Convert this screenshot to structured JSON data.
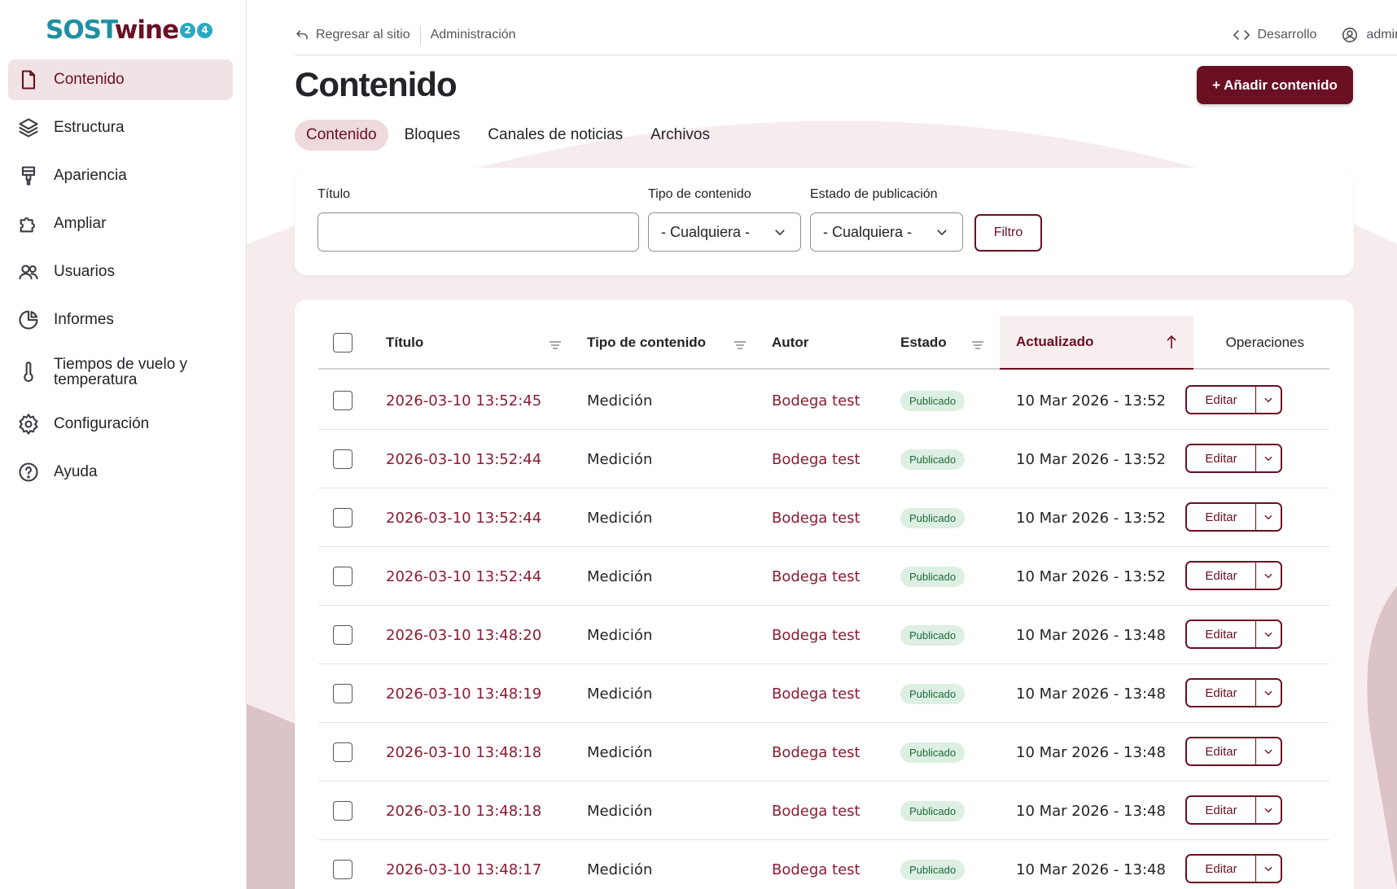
{
  "brand": {
    "logo_text_a": "SOST",
    "logo_text_b": "wine",
    "logo_badge": [
      "2",
      "4"
    ],
    "accent": "#6b0f23",
    "teal": "#1f8fa3"
  },
  "sidebar": {
    "items": [
      {
        "label": "Contenido",
        "icon": "document-icon",
        "active": true
      },
      {
        "label": "Estructura",
        "icon": "layers-icon",
        "active": false
      },
      {
        "label": "Apariencia",
        "icon": "paint-brush-icon",
        "active": false
      },
      {
        "label": "Ampliar",
        "icon": "puzzle-icon",
        "active": false
      },
      {
        "label": "Usuarios",
        "icon": "users-icon",
        "active": false
      },
      {
        "label": "Informes",
        "icon": "pie-chart-icon",
        "active": false
      },
      {
        "label": "Tiempos de vuelo y temperatura",
        "icon": "thermometer-icon",
        "active": false
      },
      {
        "label": "Configuración",
        "icon": "gear-icon",
        "active": false
      },
      {
        "label": "Ayuda",
        "icon": "help-icon",
        "active": false
      }
    ]
  },
  "topbar": {
    "back_label": "Regresar al sitio",
    "admin_label": "Administración",
    "dev_label": "Desarrollo",
    "user_label": "admin"
  },
  "page": {
    "title": "Contenido",
    "add_button": "+ Añadir contenido"
  },
  "tabs": [
    "Contenido",
    "Bloques",
    "Canales de noticias",
    "Archivos"
  ],
  "filters": {
    "title_label": "Título",
    "title_value": "",
    "type_label": "Tipo de contenido",
    "type_value": "- Cualquiera -",
    "status_label": "Estado de publicación",
    "status_value": "- Cualquiera -",
    "filter_button": "Filtro"
  },
  "table": {
    "headers": {
      "title": "Título",
      "type": "Tipo de contenido",
      "author": "Autor",
      "status": "Estado",
      "updated": "Actualizado",
      "ops": "Operaciones"
    },
    "edit_label": "Editar",
    "rows": [
      {
        "title": "2026-03-10 13:52:45",
        "type": "Medición",
        "author": "Bodega test",
        "status": "Publicado",
        "updated": "10 Mar 2026 - 13:52"
      },
      {
        "title": "2026-03-10 13:52:44",
        "type": "Medición",
        "author": "Bodega test",
        "status": "Publicado",
        "updated": "10 Mar 2026 - 13:52"
      },
      {
        "title": "2026-03-10 13:52:44",
        "type": "Medición",
        "author": "Bodega test",
        "status": "Publicado",
        "updated": "10 Mar 2026 - 13:52"
      },
      {
        "title": "2026-03-10 13:52:44",
        "type": "Medición",
        "author": "Bodega test",
        "status": "Publicado",
        "updated": "10 Mar 2026 - 13:52"
      },
      {
        "title": "2026-03-10 13:48:20",
        "type": "Medición",
        "author": "Bodega test",
        "status": "Publicado",
        "updated": "10 Mar 2026 - 13:48"
      },
      {
        "title": "2026-03-10 13:48:19",
        "type": "Medición",
        "author": "Bodega test",
        "status": "Publicado",
        "updated": "10 Mar 2026 - 13:48"
      },
      {
        "title": "2026-03-10 13:48:18",
        "type": "Medición",
        "author": "Bodega test",
        "status": "Publicado",
        "updated": "10 Mar 2026 - 13:48"
      },
      {
        "title": "2026-03-10 13:48:18",
        "type": "Medición",
        "author": "Bodega test",
        "status": "Publicado",
        "updated": "10 Mar 2026 - 13:48"
      },
      {
        "title": "2026-03-10 13:48:17",
        "type": "Medición",
        "author": "Bodega test",
        "status": "Publicado",
        "updated": "10 Mar 2026 - 13:48"
      }
    ]
  }
}
